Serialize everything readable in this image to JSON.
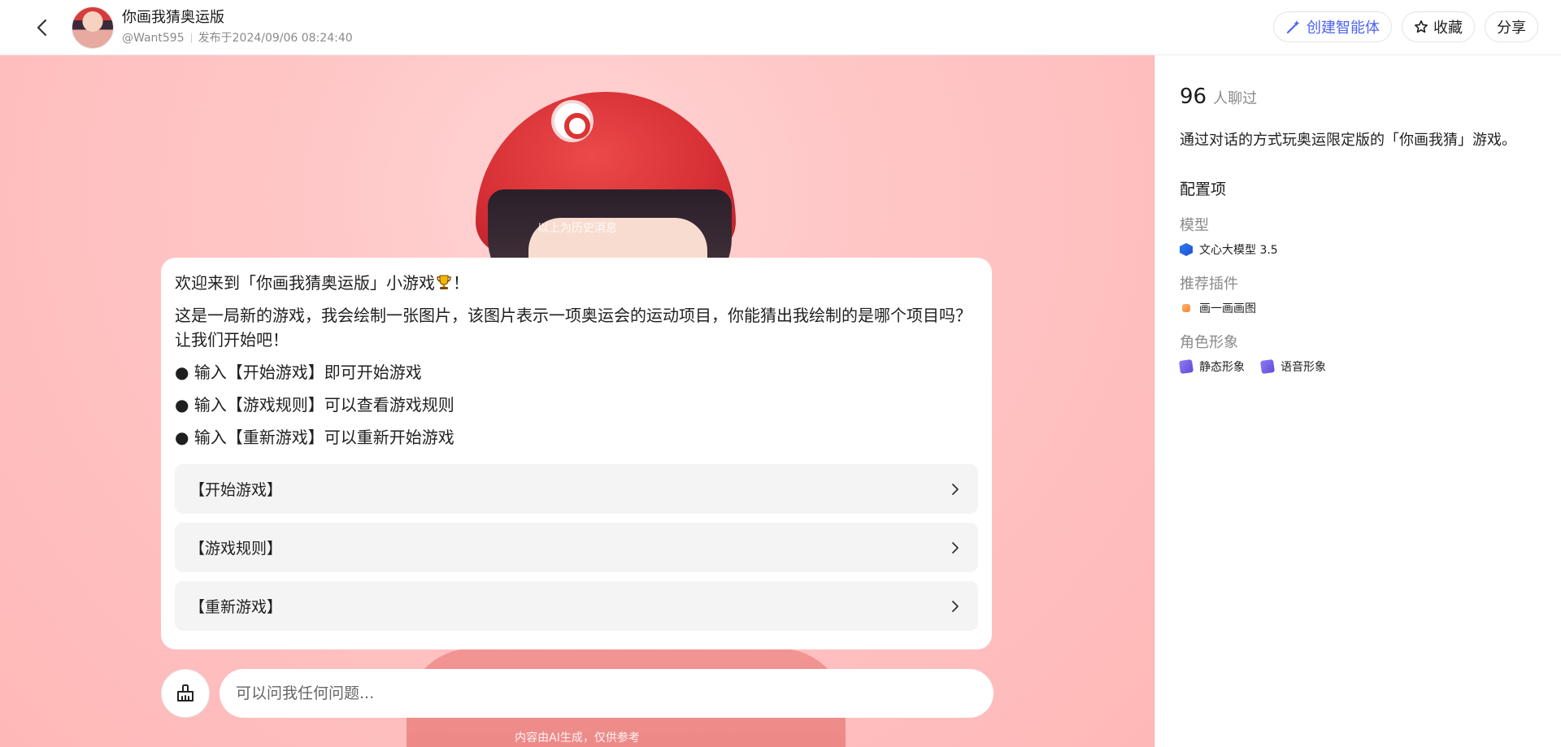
{
  "header": {
    "title": "你画我猜奥运版",
    "author": "@Want595",
    "published": "发布于2024/09/06 08:24:40",
    "actions": {
      "create_agent": "创建智能体",
      "favorite": "收藏",
      "share": "分享"
    }
  },
  "chat": {
    "history_hint": "以上为历史消息",
    "message": {
      "welcome": "欢迎来到「你画我猜奥运版」小游戏",
      "welcome_end": "！",
      "intro": "这是一局新的游戏，我会绘制一张图片，该图片表示一项奥运会的运动项目，你能猜出我绘制的是哪个项目吗？让我们开始吧！",
      "bullets": [
        "● 输入【开始游戏】即可开始游戏",
        "● 输入【游戏规则】可以查看游戏规则",
        "● 输入【重新游戏】可以重新开始游戏"
      ],
      "options": [
        "【开始游戏】",
        "【游戏规则】",
        "【重新游戏】"
      ]
    },
    "input_placeholder": "可以问我任何问题...",
    "disclaimer": "内容由AI生成，仅供参考"
  },
  "panel": {
    "chat_count": "96",
    "chat_count_label": "人聊过",
    "description": "通过对话的方式玩奥运限定版的「你画我猜」游戏。",
    "config_title": "配置项",
    "model_label": "模型",
    "model_name": "文心大模型 3.5",
    "plugins_label": "推荐插件",
    "plugin_name": "画一画画图",
    "role_label": "角色形象",
    "roles": [
      "静态形象",
      "语音形象"
    ]
  },
  "colors": {
    "accent": "#4d63f0",
    "chat_bg": "#ffc6c6"
  }
}
